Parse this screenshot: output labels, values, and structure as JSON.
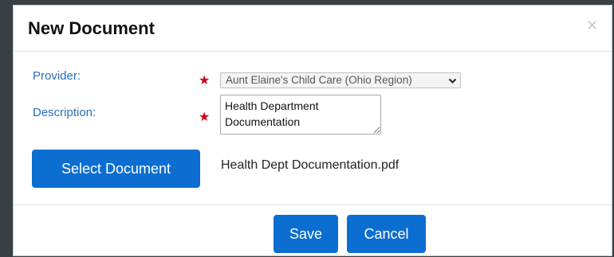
{
  "dialog": {
    "title": "New Document",
    "close_glyph": "×"
  },
  "form": {
    "provider": {
      "label": "Provider:",
      "required_mark": "★",
      "selected_value": "Aunt Elaine's Child Care (Ohio Region)",
      "chevron_glyph": "❯"
    },
    "description": {
      "label": "Description:",
      "required_mark": "★",
      "value": "Health Department Documentation"
    },
    "select_document": {
      "button_label": "Select Document",
      "selected_filename": "Health Dept Documentation.pdf"
    }
  },
  "footer": {
    "save_label": "Save",
    "cancel_label": "Cancel"
  },
  "colors": {
    "primary": "#0b6ed0",
    "label": "#2a6ebb",
    "required": "#d0021b"
  },
  "icons": [
    "close-icon",
    "required-star-icon",
    "chevron-down-icon",
    "resize-handle-icon"
  ]
}
